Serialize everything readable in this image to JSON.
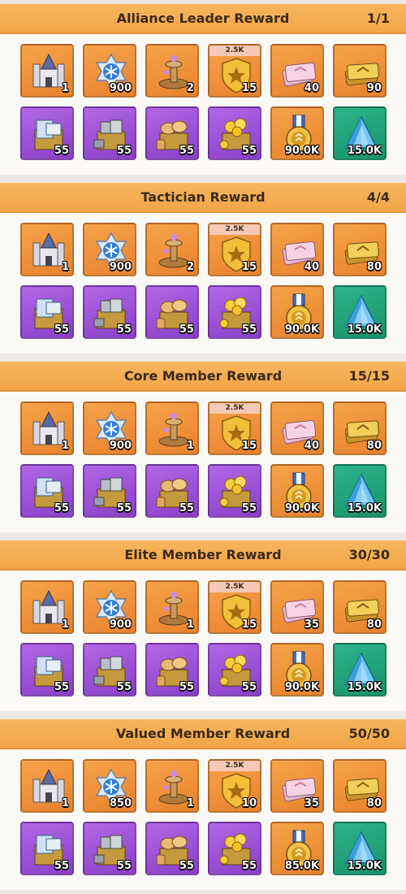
{
  "sections": [
    {
      "title": "Alliance Leader Reward",
      "count": "1/1",
      "items": [
        {
          "icon": "castle-icon",
          "qty": "1",
          "color": "orange"
        },
        {
          "icon": "snowflake-emblem-icon",
          "qty": "900",
          "color": "orange"
        },
        {
          "icon": "fountain-icon",
          "qty": "2",
          "color": "orange"
        },
        {
          "icon": "star-badge-icon",
          "qty": "15",
          "color": "orange",
          "badge": "2.5K"
        },
        {
          "icon": "pink-tickets-icon",
          "qty": "40",
          "color": "orange"
        },
        {
          "icon": "gold-tickets-icon",
          "qty": "90",
          "color": "orange"
        },
        {
          "icon": "blueprint-crate-icon",
          "qty": "55",
          "color": "purple"
        },
        {
          "icon": "steel-crate-icon",
          "qty": "55",
          "color": "purple"
        },
        {
          "icon": "bread-crate-icon",
          "qty": "55",
          "color": "purple"
        },
        {
          "icon": "coin-crate-icon",
          "qty": "55",
          "color": "purple"
        },
        {
          "icon": "gold-medal-icon",
          "qty": "90.0K",
          "color": "orange"
        },
        {
          "icon": "blue-crystal-icon",
          "qty": "15.0K",
          "color": "green"
        }
      ]
    },
    {
      "title": "Tactician Reward",
      "count": "4/4",
      "items": [
        {
          "icon": "castle-icon",
          "qty": "1",
          "color": "orange"
        },
        {
          "icon": "snowflake-emblem-icon",
          "qty": "900",
          "color": "orange"
        },
        {
          "icon": "fountain-icon",
          "qty": "2",
          "color": "orange"
        },
        {
          "icon": "star-badge-icon",
          "qty": "15",
          "color": "orange",
          "badge": "2.5K"
        },
        {
          "icon": "pink-tickets-icon",
          "qty": "40",
          "color": "orange"
        },
        {
          "icon": "gold-tickets-icon",
          "qty": "80",
          "color": "orange"
        },
        {
          "icon": "blueprint-crate-icon",
          "qty": "55",
          "color": "purple"
        },
        {
          "icon": "steel-crate-icon",
          "qty": "55",
          "color": "purple"
        },
        {
          "icon": "bread-crate-icon",
          "qty": "55",
          "color": "purple"
        },
        {
          "icon": "coin-crate-icon",
          "qty": "55",
          "color": "purple"
        },
        {
          "icon": "gold-medal-icon",
          "qty": "90.0K",
          "color": "orange"
        },
        {
          "icon": "blue-crystal-icon",
          "qty": "15.0K",
          "color": "green"
        }
      ]
    },
    {
      "title": "Core Member Reward",
      "count": "15/15",
      "items": [
        {
          "icon": "castle-icon",
          "qty": "1",
          "color": "orange"
        },
        {
          "icon": "snowflake-emblem-icon",
          "qty": "900",
          "color": "orange"
        },
        {
          "icon": "fountain-icon",
          "qty": "1",
          "color": "orange"
        },
        {
          "icon": "star-badge-icon",
          "qty": "15",
          "color": "orange",
          "badge": "2.5K"
        },
        {
          "icon": "pink-tickets-icon",
          "qty": "40",
          "color": "orange"
        },
        {
          "icon": "gold-tickets-icon",
          "qty": "80",
          "color": "orange"
        },
        {
          "icon": "blueprint-crate-icon",
          "qty": "55",
          "color": "purple"
        },
        {
          "icon": "steel-crate-icon",
          "qty": "55",
          "color": "purple"
        },
        {
          "icon": "bread-crate-icon",
          "qty": "55",
          "color": "purple"
        },
        {
          "icon": "coin-crate-icon",
          "qty": "55",
          "color": "purple"
        },
        {
          "icon": "gold-medal-icon",
          "qty": "90.0K",
          "color": "orange"
        },
        {
          "icon": "blue-crystal-icon",
          "qty": "15.0K",
          "color": "green"
        }
      ]
    },
    {
      "title": "Elite Member Reward",
      "count": "30/30",
      "items": [
        {
          "icon": "castle-icon",
          "qty": "1",
          "color": "orange"
        },
        {
          "icon": "snowflake-emblem-icon",
          "qty": "900",
          "color": "orange"
        },
        {
          "icon": "fountain-icon",
          "qty": "1",
          "color": "orange"
        },
        {
          "icon": "star-badge-icon",
          "qty": "15",
          "color": "orange",
          "badge": "2.5K"
        },
        {
          "icon": "pink-tickets-icon",
          "qty": "35",
          "color": "orange"
        },
        {
          "icon": "gold-tickets-icon",
          "qty": "80",
          "color": "orange"
        },
        {
          "icon": "blueprint-crate-icon",
          "qty": "55",
          "color": "purple"
        },
        {
          "icon": "steel-crate-icon",
          "qty": "55",
          "color": "purple"
        },
        {
          "icon": "bread-crate-icon",
          "qty": "55",
          "color": "purple"
        },
        {
          "icon": "coin-crate-icon",
          "qty": "55",
          "color": "purple"
        },
        {
          "icon": "gold-medal-icon",
          "qty": "90.0K",
          "color": "orange"
        },
        {
          "icon": "blue-crystal-icon",
          "qty": "15.0K",
          "color": "green"
        }
      ]
    },
    {
      "title": "Valued Member Reward",
      "count": "50/50",
      "items": [
        {
          "icon": "castle-icon",
          "qty": "1",
          "color": "orange"
        },
        {
          "icon": "snowflake-emblem-icon",
          "qty": "850",
          "color": "orange"
        },
        {
          "icon": "fountain-icon",
          "qty": "1",
          "color": "orange"
        },
        {
          "icon": "star-badge-icon",
          "qty": "10",
          "color": "orange",
          "badge": "2.5K"
        },
        {
          "icon": "pink-tickets-icon",
          "qty": "35",
          "color": "orange"
        },
        {
          "icon": "gold-tickets-icon",
          "qty": "80",
          "color": "orange"
        },
        {
          "icon": "blueprint-crate-icon",
          "qty": "55",
          "color": "purple"
        },
        {
          "icon": "steel-crate-icon",
          "qty": "55",
          "color": "purple"
        },
        {
          "icon": "bread-crate-icon",
          "qty": "55",
          "color": "purple"
        },
        {
          "icon": "coin-crate-icon",
          "qty": "55",
          "color": "purple"
        },
        {
          "icon": "gold-medal-icon",
          "qty": "85.0K",
          "color": "orange"
        },
        {
          "icon": "blue-crystal-icon",
          "qty": "15.0K",
          "color": "green"
        }
      ]
    }
  ]
}
